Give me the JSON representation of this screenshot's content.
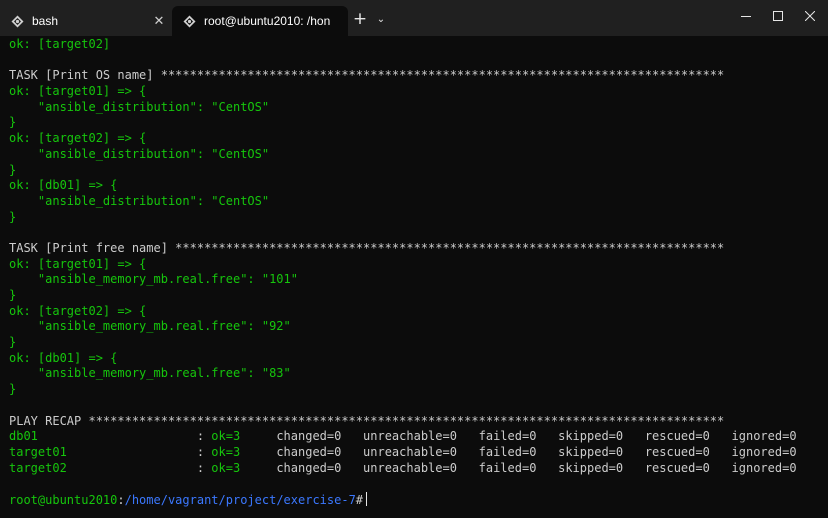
{
  "tabs": [
    {
      "title": "bash",
      "icon": "linux-icon"
    },
    {
      "title": "root@ubuntu2010: /hon",
      "icon": "linux-icon"
    }
  ],
  "window": {
    "new_tab": "+",
    "dropdown": "⌄",
    "minimize": "—",
    "maximize": "☐",
    "close": "✕",
    "tab_close": "✕"
  },
  "terminal": {
    "lines": [
      {
        "segments": [
          {
            "text": "ok: [target02]",
            "color": "green"
          }
        ]
      },
      {
        "segments": [
          {
            "text": "",
            "color": "white"
          }
        ]
      },
      {
        "segments": [
          {
            "text": "TASK [Print OS name] ******************************************************************************",
            "color": "white"
          }
        ]
      },
      {
        "segments": [
          {
            "text": "ok: [target01] => {",
            "color": "green"
          }
        ]
      },
      {
        "segments": [
          {
            "text": "    \"ansible_distribution\": \"CentOS\"",
            "color": "green"
          }
        ]
      },
      {
        "segments": [
          {
            "text": "}",
            "color": "green"
          }
        ]
      },
      {
        "segments": [
          {
            "text": "ok: [target02] => {",
            "color": "green"
          }
        ]
      },
      {
        "segments": [
          {
            "text": "    \"ansible_distribution\": \"CentOS\"",
            "color": "green"
          }
        ]
      },
      {
        "segments": [
          {
            "text": "}",
            "color": "green"
          }
        ]
      },
      {
        "segments": [
          {
            "text": "ok: [db01] => {",
            "color": "green"
          }
        ]
      },
      {
        "segments": [
          {
            "text": "    \"ansible_distribution\": \"CentOS\"",
            "color": "green"
          }
        ]
      },
      {
        "segments": [
          {
            "text": "}",
            "color": "green"
          }
        ]
      },
      {
        "segments": [
          {
            "text": "",
            "color": "white"
          }
        ]
      },
      {
        "segments": [
          {
            "text": "TASK [Print free name] ****************************************************************************",
            "color": "white"
          }
        ]
      },
      {
        "segments": [
          {
            "text": "ok: [target01] => {",
            "color": "green"
          }
        ]
      },
      {
        "segments": [
          {
            "text": "    \"ansible_memory_mb.real.free\": \"101\"",
            "color": "green"
          }
        ]
      },
      {
        "segments": [
          {
            "text": "}",
            "color": "green"
          }
        ]
      },
      {
        "segments": [
          {
            "text": "ok: [target02] => {",
            "color": "green"
          }
        ]
      },
      {
        "segments": [
          {
            "text": "    \"ansible_memory_mb.real.free\": \"92\"",
            "color": "green"
          }
        ]
      },
      {
        "segments": [
          {
            "text": "}",
            "color": "green"
          }
        ]
      },
      {
        "segments": [
          {
            "text": "ok: [db01] => {",
            "color": "green"
          }
        ]
      },
      {
        "segments": [
          {
            "text": "    \"ansible_memory_mb.real.free\": \"83\"",
            "color": "green"
          }
        ]
      },
      {
        "segments": [
          {
            "text": "}",
            "color": "green"
          }
        ]
      },
      {
        "segments": [
          {
            "text": "",
            "color": "white"
          }
        ]
      },
      {
        "segments": [
          {
            "text": "PLAY RECAP ****************************************************************************************",
            "color": "white"
          }
        ]
      }
    ],
    "recap": [
      {
        "host": "db01",
        "ok": "ok=3",
        "changed": "changed=0",
        "unreachable": "unreachable=0",
        "failed": "failed=0",
        "skipped": "skipped=0",
        "rescued": "rescued=0",
        "ignored": "ignored=0"
      },
      {
        "host": "target01",
        "ok": "ok=3",
        "changed": "changed=0",
        "unreachable": "unreachable=0",
        "failed": "failed=0",
        "skipped": "skipped=0",
        "rescued": "rescued=0",
        "ignored": "ignored=0"
      },
      {
        "host": "target02",
        "ok": "ok=3",
        "changed": "changed=0",
        "unreachable": "unreachable=0",
        "failed": "failed=0",
        "skipped": "skipped=0",
        "rescued": "rescued=0",
        "ignored": "ignored=0"
      }
    ],
    "prompt": {
      "user_host": "root@ubuntu2010",
      "sep": ":",
      "path": "/home/vagrant/project/exercise-7",
      "symbol": "#"
    }
  },
  "colors": {
    "green": "#16c60c",
    "white": "#cccccc",
    "path": "#3b78ff",
    "background": "#0c0c0c",
    "titlebar": "#202020"
  }
}
